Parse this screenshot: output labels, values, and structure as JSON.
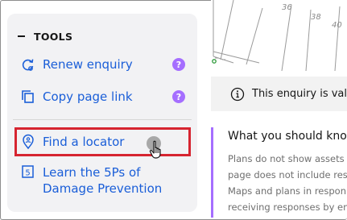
{
  "tools": {
    "title": "TOOLS",
    "items": [
      {
        "label": "Renew enquiry",
        "icon": "renew-icon",
        "help": "?"
      },
      {
        "label": "Copy page link",
        "icon": "copy-icon",
        "help": "?"
      },
      {
        "label": "Find a locator",
        "icon": "location-pin-icon"
      },
      {
        "label_line1": "Learn the 5Ps of",
        "label_line2": "Damage Prevention",
        "icon": "number-five-icon",
        "icon_text": "5"
      }
    ]
  },
  "map": {
    "lot_numbers": [
      "36",
      "38",
      "40"
    ]
  },
  "notice": {
    "text": "This enquiry is valid"
  },
  "know": {
    "title": "What you should know",
    "lines": [
      "Plans do not show assets",
      "page does not include res",
      "Maps and plans in respon",
      "receiving responses by en"
    ]
  },
  "colors": {
    "link": "#1a5ed8",
    "help_badge": "#a56eff",
    "highlight": "#d62430",
    "accent_rule": "#a56eff"
  }
}
